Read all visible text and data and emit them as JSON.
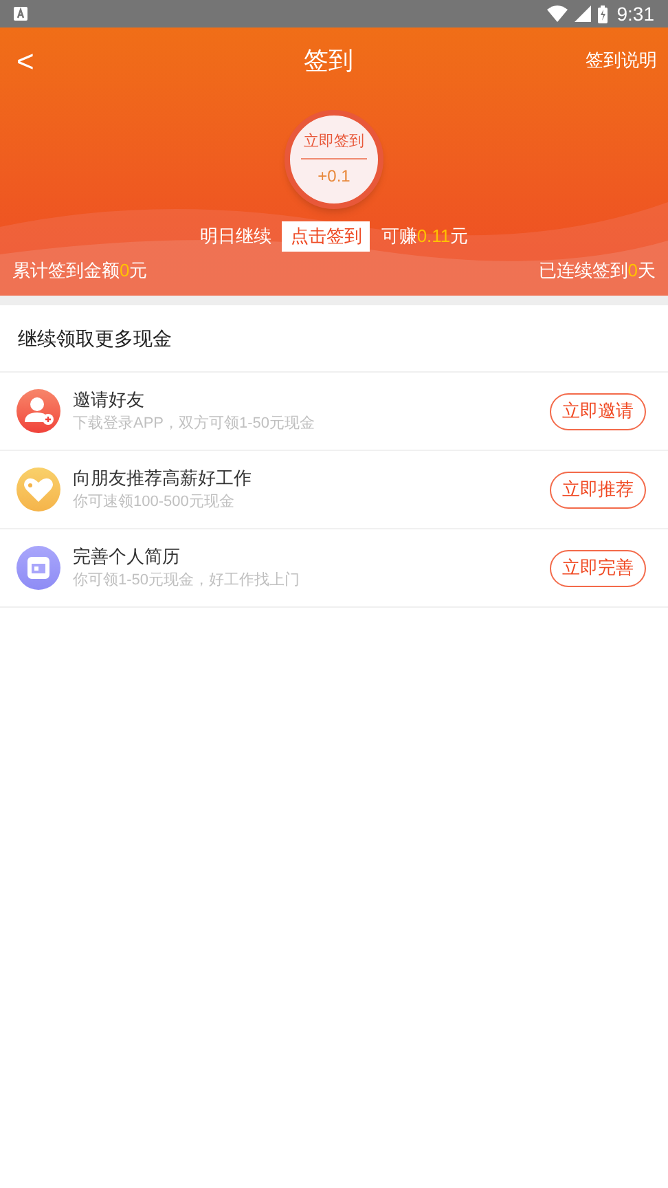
{
  "status_bar": {
    "time": "9:31"
  },
  "nav": {
    "back": "<",
    "title": "签到",
    "action": "签到说明"
  },
  "sign_in": {
    "button_label": "立即签到",
    "reward": "+0.1",
    "prompt_before": "明日继续",
    "prompt_button": "点击签到",
    "earn_prefix": "可赚",
    "earn_amount": "0.11",
    "earn_suffix": "元"
  },
  "totals": {
    "left_prefix": "累计签到金额",
    "left_value": "0",
    "left_suffix": "元",
    "right_prefix": "已连续签到",
    "right_value": "0",
    "right_suffix": "天"
  },
  "section_title": "继续领取更多现金",
  "tasks": [
    {
      "kind": "invite",
      "title": "邀请好友",
      "subtitle": "下载登录APP，双方可领1-50元现金",
      "button": "立即邀请"
    },
    {
      "kind": "recommend",
      "title": "向朋友推荐高薪好工作",
      "subtitle": "你可速领100-500元现金",
      "button": "立即推荐"
    },
    {
      "kind": "resume",
      "title": "完善个人简历",
      "subtitle": "你可领1-50元现金，好工作找上门",
      "button": "立即完善"
    }
  ]
}
